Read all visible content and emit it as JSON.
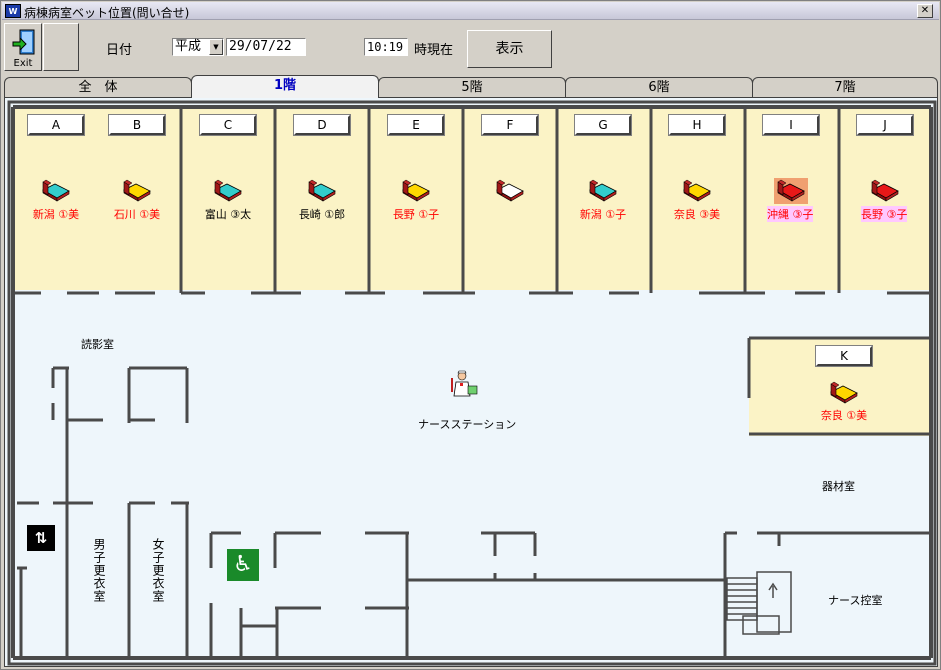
{
  "window": {
    "title": "病棟病室ベット位置(問い合せ)",
    "close_glyph": "✕",
    "icon_text": "W"
  },
  "toolbar": {
    "exit_label": "Exit",
    "date_label": "日付",
    "era": "平成",
    "date_value": "29/07/22",
    "time_value": "10:19",
    "time_suffix": "時現在",
    "show_button": "表示"
  },
  "tabs": [
    {
      "label": "全　体",
      "active": false
    },
    {
      "label": "1階",
      "active": true
    },
    {
      "label": "5階",
      "active": false
    },
    {
      "label": "6階",
      "active": false
    },
    {
      "label": "7階",
      "active": false
    }
  ],
  "rooms": [
    {
      "id": "A",
      "patient": "新潟 ①美",
      "bed_color": "cyan",
      "text_color": "#ff0000"
    },
    {
      "id": "B",
      "patient": "石川 ①美",
      "bed_color": "yellow",
      "text_color": "#ff0000"
    },
    {
      "id": "C",
      "patient": "富山 ③太",
      "bed_color": "cyan",
      "text_color": "#000000"
    },
    {
      "id": "D",
      "patient": "長崎 ①郎",
      "bed_color": "cyan",
      "text_color": "#000000"
    },
    {
      "id": "E",
      "patient": "長野 ①子",
      "bed_color": "yellow",
      "text_color": "#ff0000"
    },
    {
      "id": "F",
      "patient": "",
      "bed_color": "white",
      "text_color": "#000000"
    },
    {
      "id": "G",
      "patient": "新潟 ①子",
      "bed_color": "cyan",
      "text_color": "#ff0000"
    },
    {
      "id": "H",
      "patient": "奈良 ③美",
      "bed_color": "yellow",
      "text_color": "#ff0000"
    },
    {
      "id": "I",
      "patient": "沖縄 ③子",
      "bed_color": "red",
      "text_color": "#ff0000"
    },
    {
      "id": "J",
      "patient": "長野 ③子",
      "bed_color": "red",
      "text_color": "#ff0000"
    }
  ],
  "room_k": {
    "id": "K",
    "patient": "奈良 ①美",
    "bed_color": "yellow",
    "text_color": "#ff0000"
  },
  "map_labels": {
    "reading_room": "読影室",
    "nurse_station": "ナースステーション",
    "equipment_room": "器材室",
    "nurse_lounge": "ナース控室",
    "male_locker": "男子更衣室",
    "female_locker": "女子更衣室",
    "elevator": "⇅",
    "restroom": "♿"
  },
  "colors": {
    "room_fill": "#fbf3c6",
    "floor_fill": "#eef6fb",
    "bed_cyan": "#33cccc",
    "bed_yellow": "#ffd700",
    "bed_red": "#e81818",
    "bed_white": "#ffffff"
  }
}
